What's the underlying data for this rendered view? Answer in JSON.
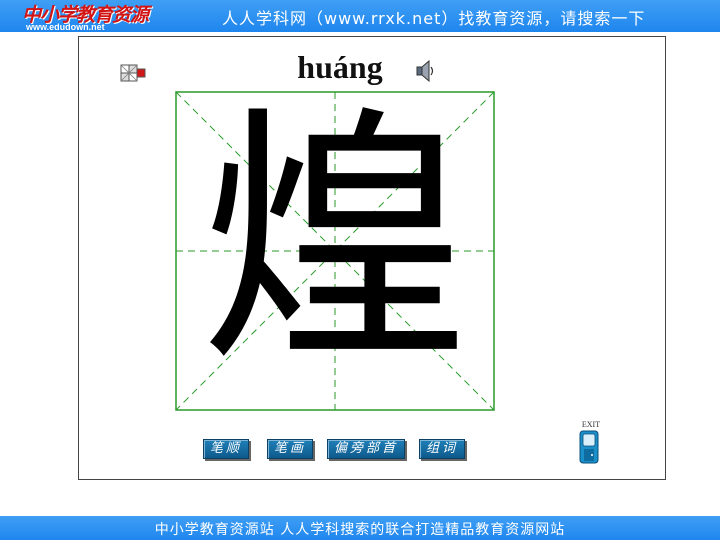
{
  "header": {
    "logo_calligraphy": "中小学教育资源",
    "logo_url": "www.edudown.net",
    "slogan": "人人学科网（www.rrxk.net）找教育资源，请搜索一下"
  },
  "lesson": {
    "pinyin": "huáng",
    "character": "煌"
  },
  "toolbar": {
    "buttons": [
      "笔顺",
      "笔画",
      "偏旁部首",
      "组词"
    ],
    "exit_label": "EXIT"
  },
  "footer": {
    "text": "中小学教育资源站  人人学科搜索的联合打造精品教育资源网站"
  },
  "icons": {
    "speaker": "speaker-icon",
    "corner_tool": "grid-tool-icon",
    "exit": "exit-door-icon"
  },
  "colors": {
    "bar_blue": "#2b8ff2",
    "grid_green": "#2a9a2a",
    "button_blue": "#15699f",
    "logo_red": "#d21414"
  }
}
